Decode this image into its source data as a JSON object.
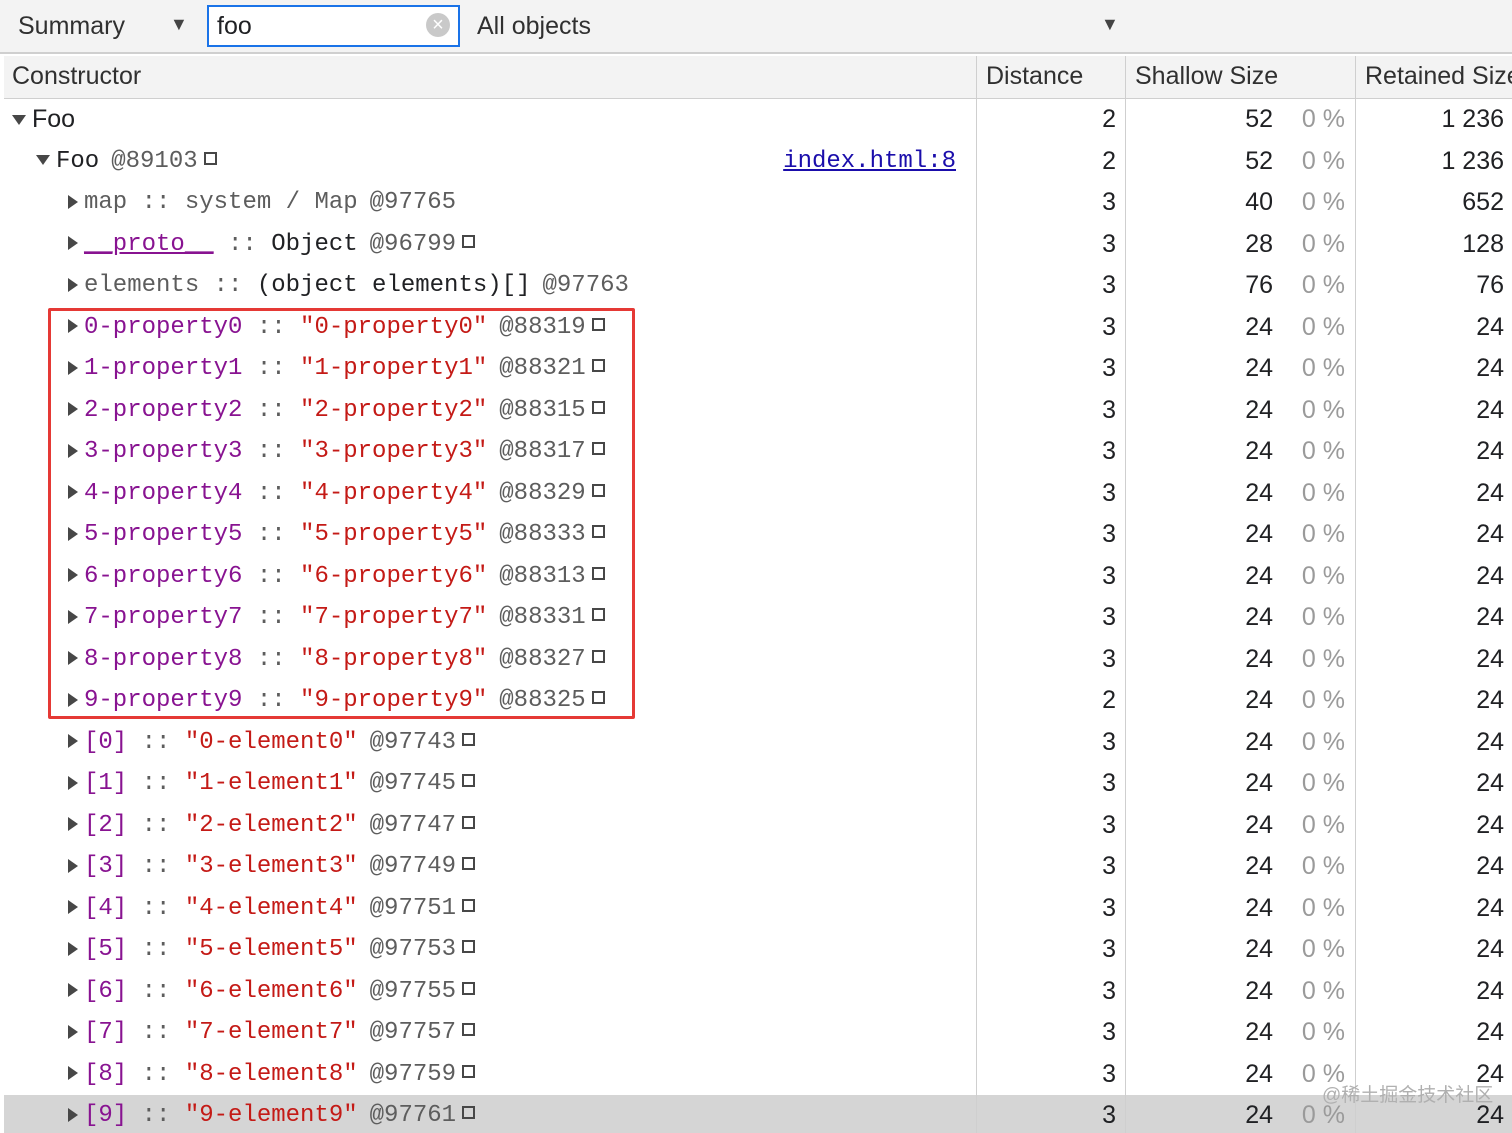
{
  "toolbar": {
    "view_label": "Summary",
    "filter_value": "foo",
    "filter_clear_glyph": "×",
    "scope_label": "All objects",
    "dropdown_glyph": "▼"
  },
  "columns": {
    "constructor": "Constructor",
    "distance": "Distance",
    "shallow": "Shallow Size",
    "retained": "Retained Size"
  },
  "rows": [
    {
      "name": "Foo",
      "sep": "",
      "value": "",
      "id": "",
      "link": "",
      "distance": "2",
      "shallow": "52",
      "shallow_pct": "0 %",
      "retained": "1 236"
    },
    {
      "name": "Foo",
      "sep": "",
      "value": "",
      "id": "@89103",
      "link": "index.html:8",
      "distance": "2",
      "shallow": "52",
      "shallow_pct": "0 %",
      "retained": "1 236"
    },
    {
      "name": "map",
      "sep": " :: ",
      "value": "system / Map",
      "id": "@97765",
      "link": "",
      "distance": "3",
      "shallow": "40",
      "shallow_pct": "0 %",
      "retained": "652"
    },
    {
      "name": "__proto__",
      "sep": " :: ",
      "value": "Object",
      "id": "@96799",
      "link": "",
      "distance": "3",
      "shallow": "28",
      "shallow_pct": "0 %",
      "retained": "128"
    },
    {
      "name": "elements",
      "sep": " :: ",
      "value": "(object elements)[]",
      "id": "@97763",
      "link": "",
      "distance": "3",
      "shallow": "76",
      "shallow_pct": "0 %",
      "retained": "76"
    },
    {
      "name": "0-property0",
      "sep": " :: ",
      "value": "\"0-property0\"",
      "id": "@88319",
      "link": "",
      "distance": "3",
      "shallow": "24",
      "shallow_pct": "0 %",
      "retained": "24"
    },
    {
      "name": "1-property1",
      "sep": " :: ",
      "value": "\"1-property1\"",
      "id": "@88321",
      "link": "",
      "distance": "3",
      "shallow": "24",
      "shallow_pct": "0 %",
      "retained": "24"
    },
    {
      "name": "2-property2",
      "sep": " :: ",
      "value": "\"2-property2\"",
      "id": "@88315",
      "link": "",
      "distance": "3",
      "shallow": "24",
      "shallow_pct": "0 %",
      "retained": "24"
    },
    {
      "name": "3-property3",
      "sep": " :: ",
      "value": "\"3-property3\"",
      "id": "@88317",
      "link": "",
      "distance": "3",
      "shallow": "24",
      "shallow_pct": "0 %",
      "retained": "24"
    },
    {
      "name": "4-property4",
      "sep": " :: ",
      "value": "\"4-property4\"",
      "id": "@88329",
      "link": "",
      "distance": "3",
      "shallow": "24",
      "shallow_pct": "0 %",
      "retained": "24"
    },
    {
      "name": "5-property5",
      "sep": " :: ",
      "value": "\"5-property5\"",
      "id": "@88333",
      "link": "",
      "distance": "3",
      "shallow": "24",
      "shallow_pct": "0 %",
      "retained": "24"
    },
    {
      "name": "6-property6",
      "sep": " :: ",
      "value": "\"6-property6\"",
      "id": "@88313",
      "link": "",
      "distance": "3",
      "shallow": "24",
      "shallow_pct": "0 %",
      "retained": "24"
    },
    {
      "name": "7-property7",
      "sep": " :: ",
      "value": "\"7-property7\"",
      "id": "@88331",
      "link": "",
      "distance": "3",
      "shallow": "24",
      "shallow_pct": "0 %",
      "retained": "24"
    },
    {
      "name": "8-property8",
      "sep": " :: ",
      "value": "\"8-property8\"",
      "id": "@88327",
      "link": "",
      "distance": "3",
      "shallow": "24",
      "shallow_pct": "0 %",
      "retained": "24"
    },
    {
      "name": "9-property9",
      "sep": " :: ",
      "value": "\"9-property9\"",
      "id": "@88325",
      "link": "",
      "distance": "2",
      "shallow": "24",
      "shallow_pct": "0 %",
      "retained": "24"
    },
    {
      "name": "[0]",
      "sep": " :: ",
      "value": "\"0-element0\"",
      "id": "@97743",
      "link": "",
      "distance": "3",
      "shallow": "24",
      "shallow_pct": "0 %",
      "retained": "24"
    },
    {
      "name": "[1]",
      "sep": " :: ",
      "value": "\"1-element1\"",
      "id": "@97745",
      "link": "",
      "distance": "3",
      "shallow": "24",
      "shallow_pct": "0 %",
      "retained": "24"
    },
    {
      "name": "[2]",
      "sep": " :: ",
      "value": "\"2-element2\"",
      "id": "@97747",
      "link": "",
      "distance": "3",
      "shallow": "24",
      "shallow_pct": "0 %",
      "retained": "24"
    },
    {
      "name": "[3]",
      "sep": " :: ",
      "value": "\"3-element3\"",
      "id": "@97749",
      "link": "",
      "distance": "3",
      "shallow": "24",
      "shallow_pct": "0 %",
      "retained": "24"
    },
    {
      "name": "[4]",
      "sep": " :: ",
      "value": "\"4-element4\"",
      "id": "@97751",
      "link": "",
      "distance": "3",
      "shallow": "24",
      "shallow_pct": "0 %",
      "retained": "24"
    },
    {
      "name": "[5]",
      "sep": " :: ",
      "value": "\"5-element5\"",
      "id": "@97753",
      "link": "",
      "distance": "3",
      "shallow": "24",
      "shallow_pct": "0 %",
      "retained": "24"
    },
    {
      "name": "[6]",
      "sep": " :: ",
      "value": "\"6-element6\"",
      "id": "@97755",
      "link": "",
      "distance": "3",
      "shallow": "24",
      "shallow_pct": "0 %",
      "retained": "24"
    },
    {
      "name": "[7]",
      "sep": " :: ",
      "value": "\"7-element7\"",
      "id": "@97757",
      "link": "",
      "distance": "3",
      "shallow": "24",
      "shallow_pct": "0 %",
      "retained": "24"
    },
    {
      "name": "[8]",
      "sep": " :: ",
      "value": "\"8-element8\"",
      "id": "@97759",
      "link": "",
      "distance": "3",
      "shallow": "24",
      "shallow_pct": "0 %",
      "retained": "24"
    },
    {
      "name": "[9]",
      "sep": " :: ",
      "value": "\"9-element9\"",
      "id": "@97761",
      "link": "",
      "distance": "3",
      "shallow": "24",
      "shallow_pct": "0 %",
      "retained": "24"
    }
  ],
  "watermark": "@稀土掘金技术社区"
}
